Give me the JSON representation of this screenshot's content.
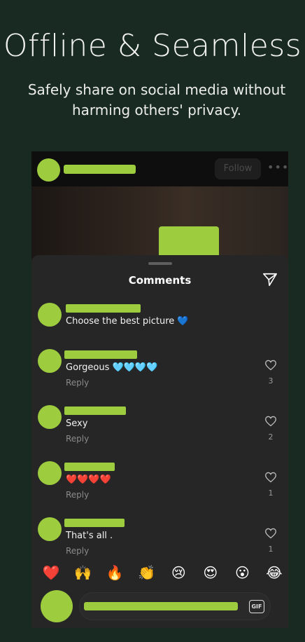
{
  "promo": {
    "headline": "Offline & Seamless",
    "subline": "Safely share on social media without harming others' privacy."
  },
  "post": {
    "follow_label": "Follow",
    "more_label": "•••"
  },
  "comments_sheet": {
    "title": "Comments",
    "items": [
      {
        "text": "Choose the best picture 💙",
        "reply": "",
        "likes": ""
      },
      {
        "text": "Gorgeous 🩵🩵🩵🩵",
        "reply": "Reply",
        "likes": "3"
      },
      {
        "text": "Sexy",
        "reply": "Reply",
        "likes": "2"
      },
      {
        "text": "❤️❤️❤️❤️",
        "reply": "Reply",
        "likes": "1"
      },
      {
        "text": "That's all .",
        "reply": "Reply",
        "likes": "1"
      }
    ],
    "reactions": [
      "❤️",
      "🙌",
      "🔥",
      "👏",
      "😢",
      "😍",
      "😮",
      "😂"
    ]
  },
  "composer": {
    "gif_label": "GIF"
  },
  "colors": {
    "background": "#182a22",
    "redaction": "#9ecc3f",
    "sheet": "#262626"
  }
}
